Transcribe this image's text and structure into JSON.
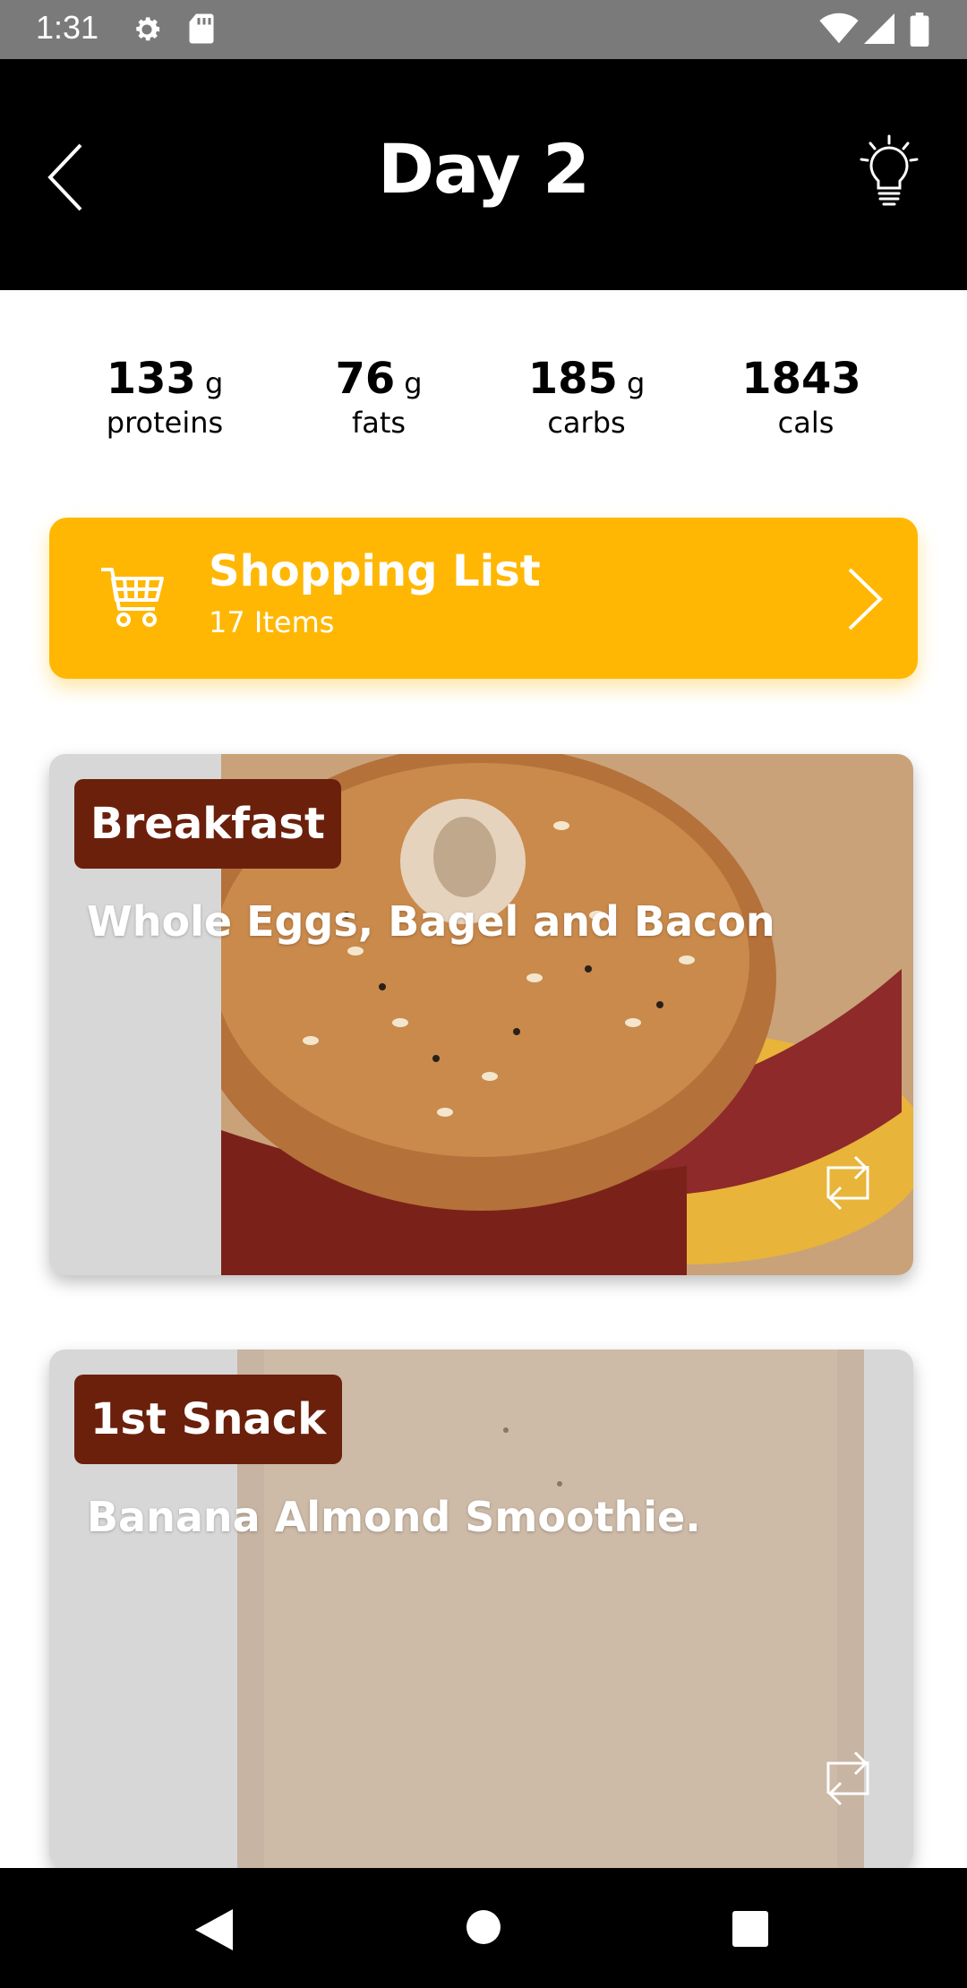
{
  "status_bar": {
    "time": "1:31",
    "icons": [
      "gear-icon",
      "sd-card-icon",
      "wifi-icon",
      "signal-icon",
      "battery-icon"
    ]
  },
  "header": {
    "title": "Day 2",
    "back_icon": "chevron-left-icon",
    "tip_icon": "lightbulb-icon"
  },
  "macros": [
    {
      "value": "133",
      "unit": "g",
      "label": "proteins"
    },
    {
      "value": "76",
      "unit": "g",
      "label": "fats"
    },
    {
      "value": "185",
      "unit": "g",
      "label": "carbs"
    },
    {
      "value": "1843",
      "unit": "",
      "label": "cals"
    }
  ],
  "shopping_list": {
    "title": "Shopping List",
    "subtitle": "17 Items",
    "icon": "cart-icon",
    "accent_color": "#ffb703"
  },
  "meals": [
    {
      "tag": "Breakfast",
      "name": "Whole Eggs, Bagel and Bacon",
      "swap_icon": "swap-icon"
    },
    {
      "tag": "1st Snack",
      "name": "Banana Almond Smoothie.",
      "swap_icon": "swap-icon"
    }
  ],
  "colors": {
    "header_bg": "#000000",
    "tag_bg": "#6b200c",
    "card_bg": "#d7d7d7"
  },
  "nav_bar": {
    "icons": [
      "nav-back-icon",
      "nav-home-icon",
      "nav-recents-icon"
    ]
  }
}
